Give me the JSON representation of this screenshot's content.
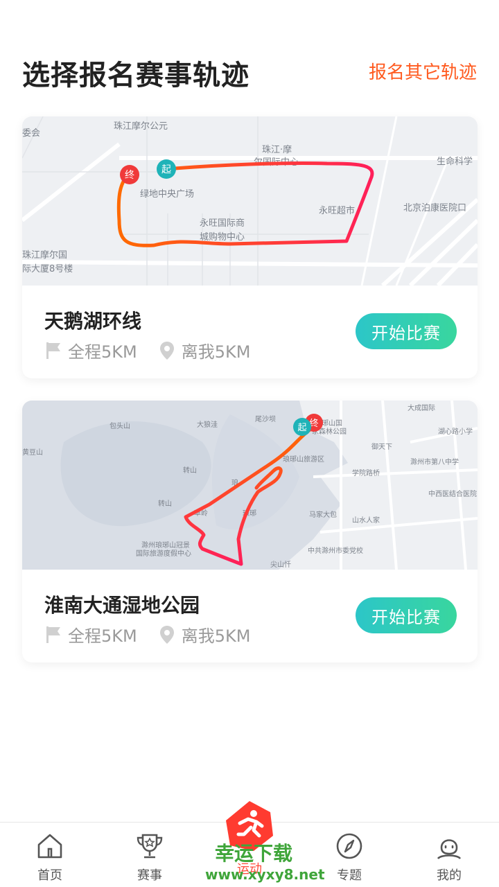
{
  "header": {
    "title": "选择报名赛事轨迹",
    "other_link": "报名其它轨迹"
  },
  "routes": [
    {
      "name": "天鹅湖环线",
      "distance": "全程5KM",
      "from_me": "离我5KM",
      "button": "开始比赛",
      "start_marker": "起",
      "end_marker": "终",
      "map_labels": [
        "珠江摩尔公元",
        "委会",
        "珠江·摩",
        "尔国际中心",
        "生命科学",
        "绿地中央广场",
        "永旺超市",
        "北京泊康医院口",
        "永旺国际商",
        "城购物中心",
        "珠江摩尔国",
        "际大厦8号楼"
      ]
    },
    {
      "name": "淮南大通湿地公园",
      "distance": "全程5KM",
      "from_me": "离我5KM",
      "button": "开始比赛",
      "start_marker": "起",
      "end_marker": "终",
      "map_labels": [
        "大成国际",
        "包头山",
        "大狼洼",
        "尾沙坝",
        "琅琊山国",
        "家森林公园",
        "御天下",
        "湖心路小学",
        "黄豆山",
        "转山",
        "琅琊山旅游区",
        "学院路桥",
        "滁州市第八中学",
        "琅",
        "中西医结合医院",
        "转山",
        "草岭",
        "琅琊",
        "马家大包",
        "山水人家",
        "滁州琅琊山冠景",
        "国际旅游度假中心",
        "中共滁州市委党校",
        "尖山忏"
      ]
    }
  ],
  "tabs": [
    {
      "label": "首页",
      "icon": "home-icon"
    },
    {
      "label": "赛事",
      "icon": "trophy-icon"
    },
    {
      "label": "运动",
      "icon": "running-man-icon"
    },
    {
      "label": "专题",
      "icon": "compass-icon"
    },
    {
      "label": "我的",
      "icon": "profile-icon"
    }
  ],
  "watermark": {
    "line1": "幸运下载",
    "line2": "www.xyxy8.net"
  },
  "colors": {
    "accent_orange": "#ff5a1f",
    "button_gradient_start": "#2cc6c8",
    "button_gradient_end": "#39d69e",
    "track_start": "#ff6a00",
    "track_end": "#ff1f5a",
    "start_marker": "#1fb3b8",
    "end_marker": "#f03a3a"
  }
}
